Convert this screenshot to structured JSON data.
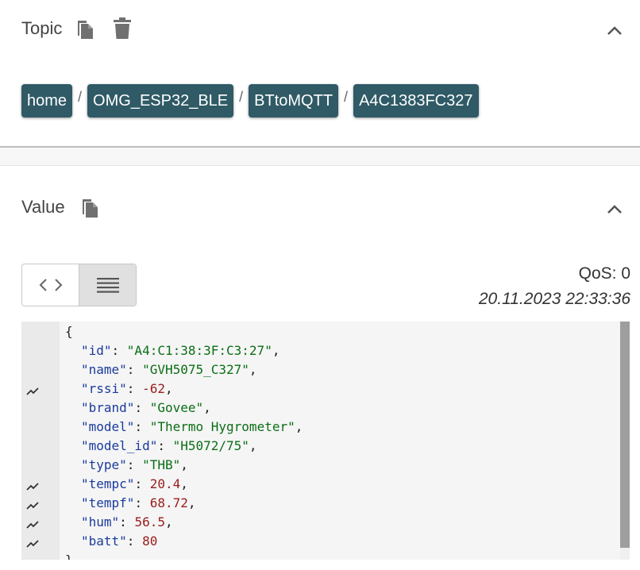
{
  "topic_section": {
    "title": "Topic",
    "icons": [
      "copy-icon",
      "delete-icon",
      "chevron-up-icon"
    ],
    "breadcrumbs": [
      "home",
      "OMG_ESP32_BLE",
      "BTtoMQTT",
      "A4C1383FC327"
    ],
    "separator": "/"
  },
  "value_section": {
    "title": "Value",
    "icons": [
      "copy-icon",
      "chevron-up-icon"
    ],
    "qos": "QoS: 0",
    "timestamp": "20.11.2023 22:33:36",
    "view_modes": [
      "code-view-icon",
      "list-view-icon"
    ],
    "selected_view": "list-view-icon"
  },
  "json_lines": [
    {
      "text": "{",
      "spark": false
    },
    {
      "key": "\"id\"",
      "value": "\"A4:C1:38:3F:C3:27\"",
      "kind": "string",
      "comma": true,
      "spark": false
    },
    {
      "key": "\"name\"",
      "value": "\"GVH5075_C327\"",
      "kind": "string",
      "comma": true,
      "spark": false
    },
    {
      "key": "\"rssi\"",
      "value": "-62",
      "kind": "number",
      "comma": true,
      "spark": true
    },
    {
      "key": "\"brand\"",
      "value": "\"Govee\"",
      "kind": "string",
      "comma": true,
      "spark": false
    },
    {
      "key": "\"model\"",
      "value": "\"Thermo Hygrometer\"",
      "kind": "string",
      "comma": true,
      "spark": false
    },
    {
      "key": "\"model_id\"",
      "value": "\"H5072/75\"",
      "kind": "string",
      "comma": true,
      "spark": false
    },
    {
      "key": "\"type\"",
      "value": "\"THB\"",
      "kind": "string",
      "comma": true,
      "spark": false
    },
    {
      "key": "\"tempc\"",
      "value": "20.4",
      "kind": "number",
      "comma": true,
      "spark": true
    },
    {
      "key": "\"tempf\"",
      "value": "68.72",
      "kind": "number",
      "comma": true,
      "spark": true
    },
    {
      "key": "\"hum\"",
      "value": "56.5",
      "kind": "number",
      "comma": true,
      "spark": true
    },
    {
      "key": "\"batt\"",
      "value": "80",
      "kind": "number",
      "comma": false,
      "spark": true
    },
    {
      "text": "}",
      "spark": false
    }
  ],
  "colors": {
    "chip_bg": "#2f5a66",
    "key": "#1a3b9c",
    "string": "#0b6e16",
    "number": "#9a1c1c"
  }
}
